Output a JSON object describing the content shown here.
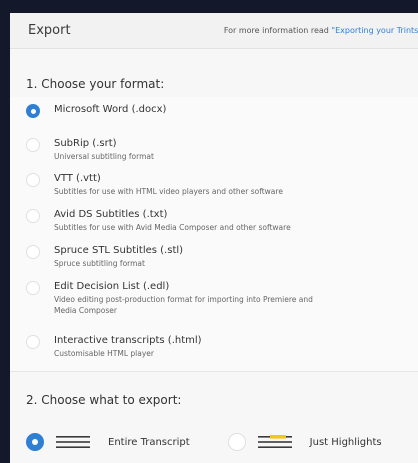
{
  "header": {
    "title": "Export",
    "info_prefix": "For more information read ",
    "info_link": "\"Exporting your Trints\""
  },
  "section1": {
    "title": "1. Choose your format:"
  },
  "formats": [
    {
      "label": "Microsoft Word (.docx)",
      "desc": "",
      "selected": true
    },
    {
      "label": "SubRip (.srt)",
      "desc": "Universal subtitling format",
      "selected": false
    },
    {
      "label": "VTT (.vtt)",
      "desc": "Subtitles for use with HTML video players and other software",
      "selected": false
    },
    {
      "label": "Avid DS Subtitles (.txt)",
      "desc": "Subtitles for use with Avid Media Composer and other software",
      "selected": false
    },
    {
      "label": "Spruce STL Subtitles (.stl)",
      "desc": "Spruce subtitling format",
      "selected": false
    },
    {
      "label": "Edit Decision List (.edl)",
      "desc": "Video editing post-production format for importing into Premiere and",
      "desc2": "Media Composer",
      "selected": false
    },
    {
      "label": "Interactive transcripts (.html)",
      "desc": "Customisable HTML player",
      "selected": false
    }
  ],
  "section2": {
    "title": "2. Choose what to export:"
  },
  "export_options": [
    {
      "label": "Entire Transcript",
      "selected": true,
      "icon": "lines-icon"
    },
    {
      "label": "Just Highlights",
      "selected": false,
      "icon": "highlight-lines-icon"
    }
  ],
  "colors": {
    "accent": "#2f7fd3",
    "highlight": "#f5c518",
    "background": "#14182b"
  }
}
